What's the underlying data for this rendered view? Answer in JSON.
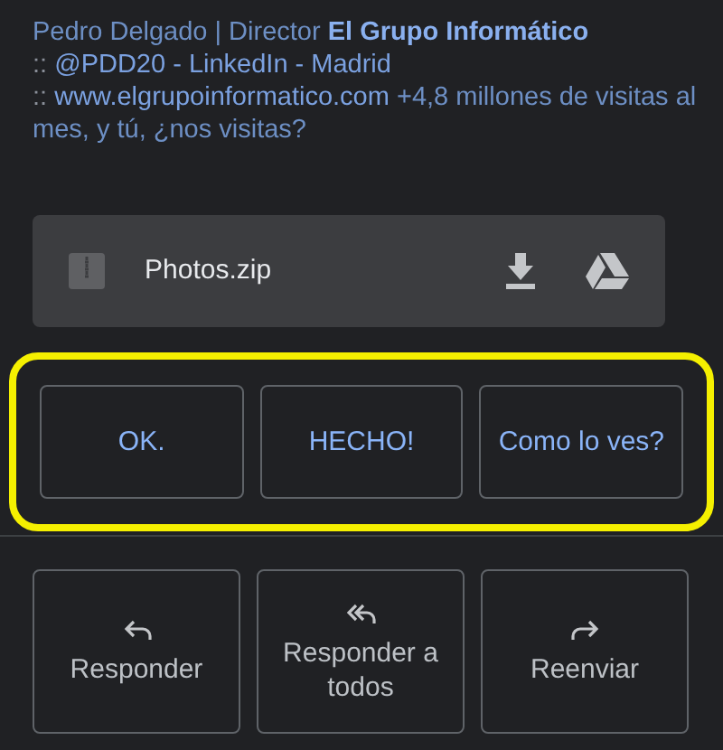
{
  "signature": {
    "lines": [
      {
        "text": "Pedro Delgado | Director **El Grupo Informático**"
      },
      {
        "prefix": ":: ",
        "link": "@PDD20 - LinkedIn - Madrid"
      },
      {
        "prefix": ":: ",
        "link": "www.elgrupoinformatico.com",
        "text": " +4,8 millones de visitas al mes, y tú, ¿nos visitas?"
      }
    ]
  },
  "attachment": {
    "name": "Photos.zip"
  },
  "smart_replies": [
    "OK.",
    "HECHO!",
    "Como lo ves?"
  ],
  "actions": [
    {
      "kind": "reply",
      "label": "Responder"
    },
    {
      "kind": "reply_all",
      "label": "Responder a todos"
    },
    {
      "kind": "forward",
      "label": "Reenviar"
    }
  ]
}
